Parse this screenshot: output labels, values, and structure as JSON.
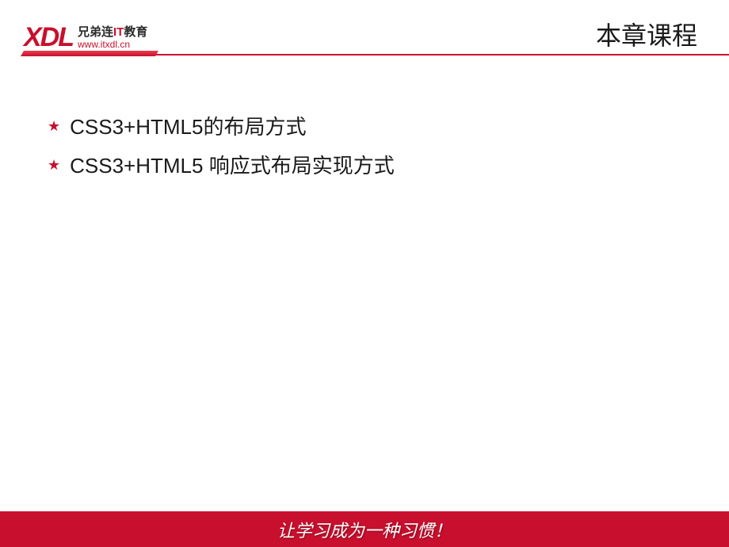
{
  "header": {
    "logo_text": "XDL",
    "logo_cn_prefix": "兄弟连",
    "logo_cn_it": "IT",
    "logo_cn_suffix": "教育",
    "logo_url": "www.itxdl.cn",
    "page_title": "本章课程"
  },
  "content": {
    "bullets": [
      {
        "text": "CSS3+HTML5的布局方式"
      },
      {
        "text": "CSS3+HTML5 响应式布局实现方式"
      }
    ]
  },
  "footer": {
    "slogan": "让学习成为一种习惯！"
  }
}
